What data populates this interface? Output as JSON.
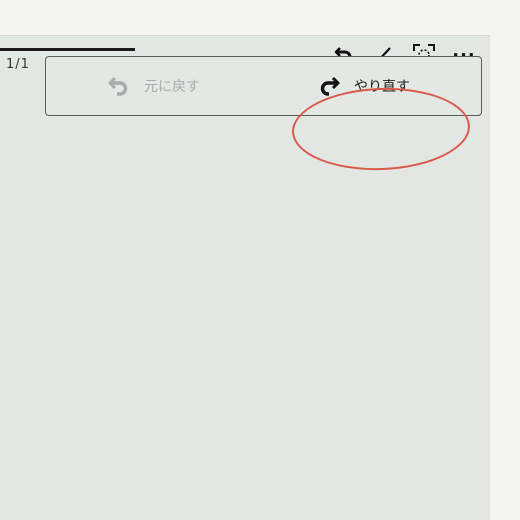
{
  "page": {
    "indicator": "1/1",
    "reading_progress": 0.28
  },
  "toolbar": {
    "undo_icon": "undo-arrow-icon",
    "pen_icon": "pen-icon",
    "fullscreen_icon": "fullscreen-icon",
    "more_label": "···"
  },
  "popup": {
    "undo_label": "元に戻す",
    "redo_label": "やり直す"
  },
  "colors": {
    "highlight": "#d9584a",
    "disabled_text": "#a8acaa",
    "active_text": "#1d1d1d"
  }
}
